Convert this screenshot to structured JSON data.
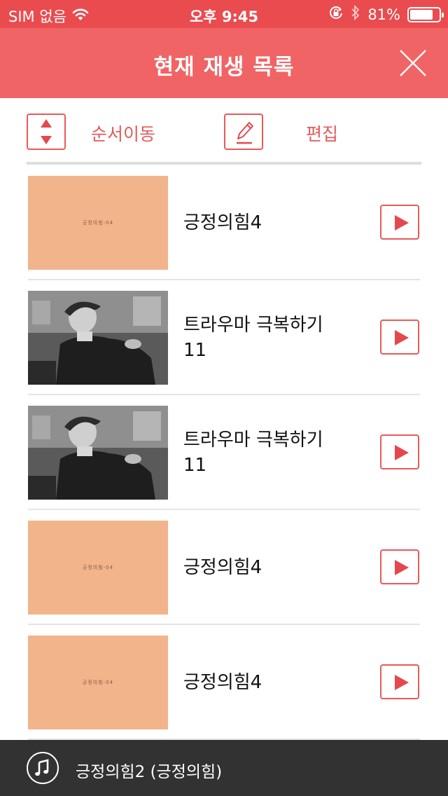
{
  "status_bar": {
    "carrier": "SIM 없음",
    "time": "오후 9:45",
    "battery": "81%",
    "battery_level": 0.81,
    "icons": [
      "wifi-icon",
      "rotation-lock-icon",
      "bluetooth-icon",
      "battery-icon"
    ]
  },
  "header": {
    "title": "현재 재생 목록",
    "close_icon": "close-icon"
  },
  "toolbar": {
    "reorder_label": "순서이동",
    "reorder_icon": "reorder-arrows-icon",
    "edit_label": "편집",
    "edit_icon": "pencil-icon"
  },
  "playlist": {
    "items": [
      {
        "title": "긍정의힘4",
        "thumbnail": "peach",
        "thumb_caption": "긍정의힘-04"
      },
      {
        "title": "트라우마 극복하기 11",
        "thumbnail": "photo"
      },
      {
        "title": "트라우마 극복하기 11",
        "thumbnail": "photo"
      },
      {
        "title": "긍정의힘4",
        "thumbnail": "peach",
        "thumb_caption": "긍정의힘-04"
      },
      {
        "title": "긍정의힘4",
        "thumbnail": "peach",
        "thumb_caption": "긍정의힘-04"
      }
    ],
    "play_icon": "play-icon"
  },
  "now_playing": {
    "title": "긍정의힘2 (긍정의힘)",
    "icon": "music-note-icon"
  },
  "colors": {
    "status_bar_bg": "#e94b4f",
    "header_bg": "#f06466",
    "accent": "#e85a5a",
    "now_playing_bg": "#323232",
    "thumb_peach": "#f2b48b"
  }
}
